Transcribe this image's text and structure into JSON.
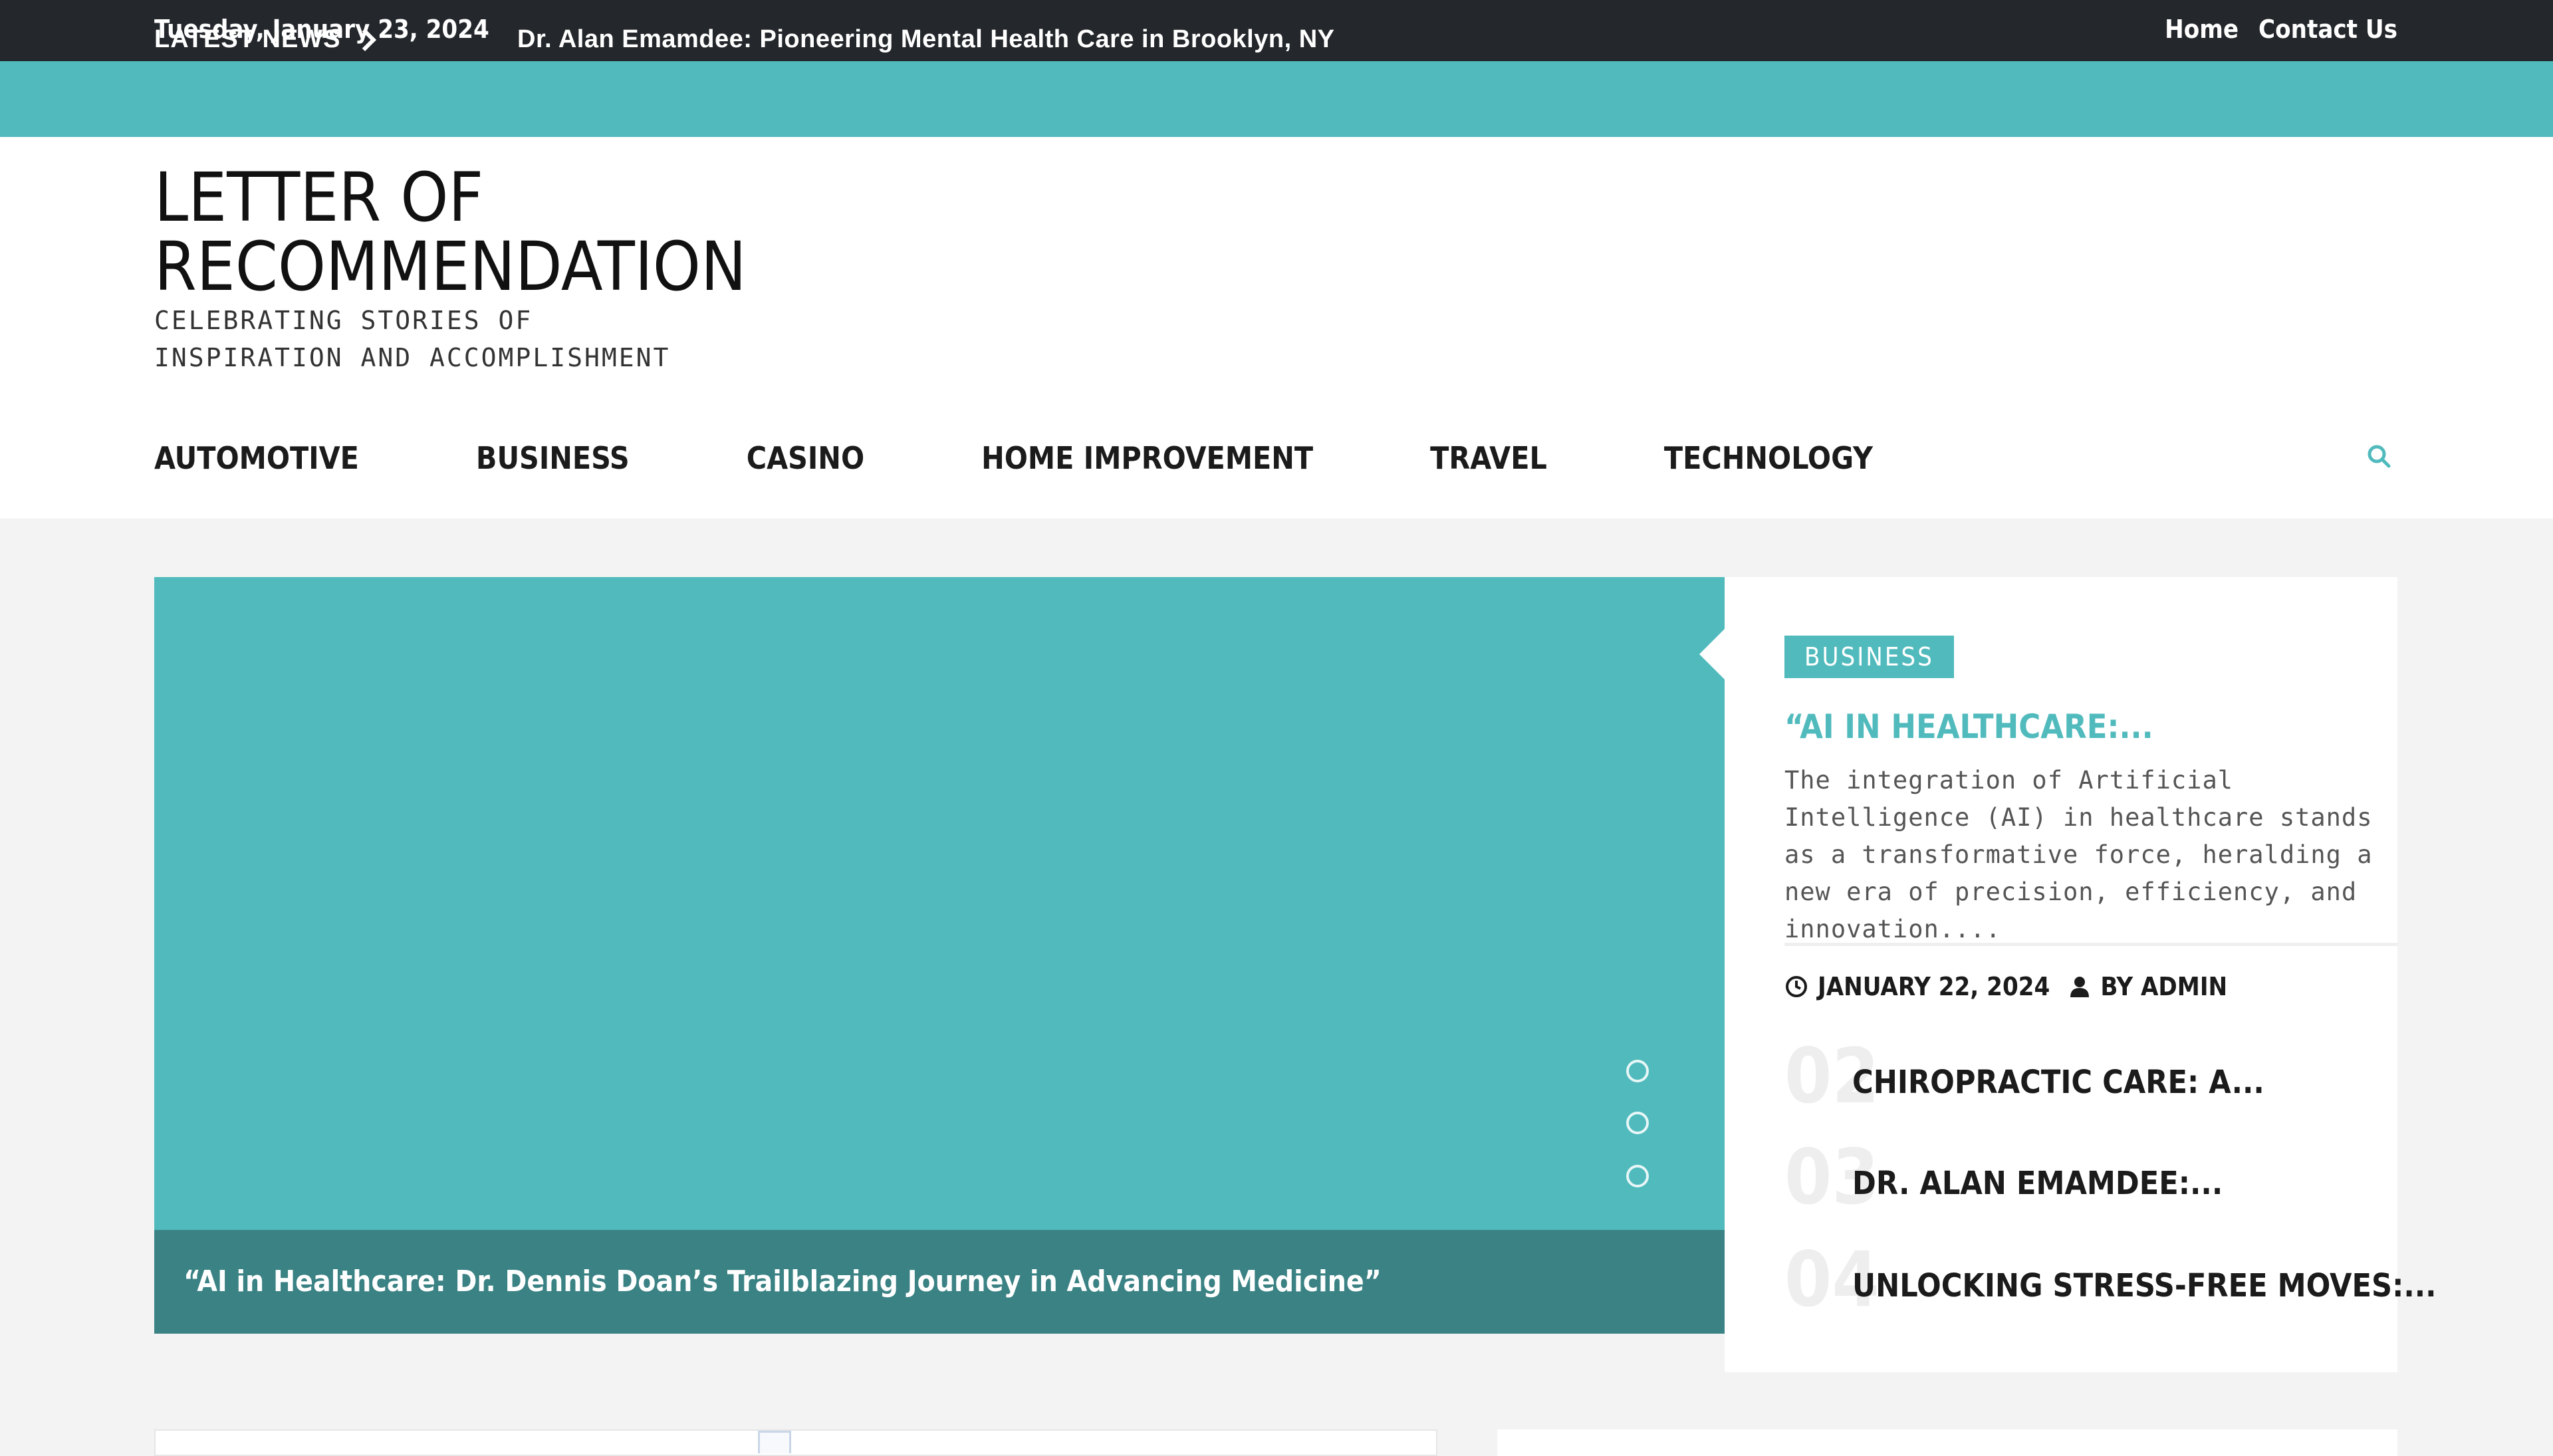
{
  "topbar": {
    "date": "Tuesday, January 23, 2024",
    "links": [
      "Home",
      "Contact Us"
    ]
  },
  "ticker": {
    "label": "LATEST NEWS",
    "headline": "Dr. Alan Emamdee: Pioneering Mental Health Care in Brooklyn, NY"
  },
  "site": {
    "title_line1": "LETTER OF",
    "title_line2": "RECOMMENDATION",
    "tagline_line1": "CELEBRATING STORIES OF",
    "tagline_line2": "INSPIRATION AND ACCOMPLISHMENT"
  },
  "nav": {
    "items": [
      "AUTOMOTIVE",
      "BUSINESS",
      "CASINO",
      "HOME IMPROVEMENT",
      "TRAVEL",
      "TECHNOLOGY"
    ]
  },
  "slider": {
    "caption": "“AI in Healthcare: Dr. Dennis Doan’s Trailblazing Journey in Advancing Medicine”",
    "dot_count": 3
  },
  "featured": {
    "category": "BUSINESS",
    "title": "“AI IN HEALTHCARE:...",
    "excerpt": "The integration of Artificial Intelligence (AI) in healthcare stands as a transformative force, heralding a new era of precision, efficiency, and innovation....",
    "date": "JANUARY 22, 2024",
    "author": "BY ADMIN"
  },
  "post_list": [
    {
      "number": "02",
      "title": "CHIROPRACTIC CARE: A..."
    },
    {
      "number": "03",
      "title": "DR. ALAN EMAMDEE:..."
    },
    {
      "number": "04",
      "title": "UNLOCKING STRESS-FREE MOVES:..."
    }
  ],
  "colors": {
    "accent": "#50babd",
    "topbar": "#24272b",
    "caption_bg": "#3b8284"
  },
  "icons": {
    "search": "search-icon",
    "clock": "clock-icon",
    "user": "user-icon",
    "ticker_arrow": "chevron-right-icon"
  }
}
